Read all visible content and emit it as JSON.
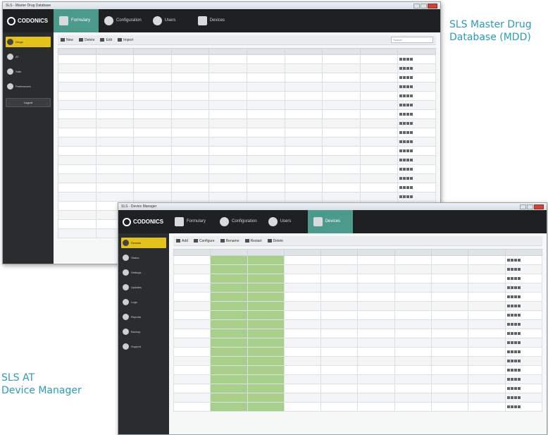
{
  "captions": {
    "top_right": "SLS Master Drug\nDatabase (MDD)",
    "bottom_left": "SLS AT\nDevice Manager"
  },
  "colors": {
    "accent": "#4c9a8c",
    "caption": "#2b9bb8",
    "highlight": "#e5c21b",
    "green_cell": "#a8cf8c"
  },
  "mdd_window": {
    "title": "SLS - Master Drug Database",
    "logo": "CODONICS",
    "tabs": [
      {
        "label": "Formulary",
        "icon": "formulary-icon",
        "active": true
      },
      {
        "label": "Configuration",
        "icon": "gear-icon",
        "active": false
      },
      {
        "label": "Users",
        "icon": "user-icon",
        "active": false
      },
      {
        "label": "Devices",
        "icon": "device-icon",
        "active": false
      }
    ],
    "sidebar": [
      {
        "label": "Drugs",
        "badge": "",
        "icon": "pill-icon"
      },
      {
        "label": "AT",
        "badge": "",
        "icon": "folder-icon"
      },
      {
        "label": "Safe",
        "badge": "",
        "icon": "lock-icon"
      },
      {
        "label": "Preferences",
        "badge": "",
        "icon": "settings-icon"
      }
    ],
    "logout": "Logout",
    "toolbar": [
      "New",
      "Delete",
      "Edit",
      "Import"
    ],
    "search_placeholder": "Search"
  },
  "device_window": {
    "title": "SLS - Device Manager",
    "logo": "CODONICS",
    "tabs": [
      {
        "label": "Formulary",
        "icon": "formulary-icon",
        "active": false
      },
      {
        "label": "Configuration",
        "icon": "gear-icon",
        "active": false
      },
      {
        "label": "Users",
        "icon": "user-icon",
        "active": false
      },
      {
        "label": "Devices",
        "icon": "device-icon",
        "active": true
      }
    ],
    "sidebar": [
      {
        "label": "Devices",
        "badge": "",
        "icon": "device-icon"
      },
      {
        "label": "Status",
        "badge": "",
        "icon": "status-icon"
      },
      {
        "label": "Settings",
        "badge": "",
        "icon": "gear-icon"
      },
      {
        "label": "Updates",
        "badge": "",
        "icon": "update-icon"
      },
      {
        "label": "Logs",
        "badge": "",
        "icon": "log-icon"
      },
      {
        "label": "Reports",
        "badge": "",
        "icon": "report-icon"
      },
      {
        "label": "Backup",
        "badge": "",
        "icon": "backup-icon"
      },
      {
        "label": "Support",
        "badge": "",
        "icon": "support-icon"
      }
    ],
    "toolbar": [
      "Add",
      "Configure",
      "Rename",
      "Restart",
      "Delete"
    ]
  }
}
